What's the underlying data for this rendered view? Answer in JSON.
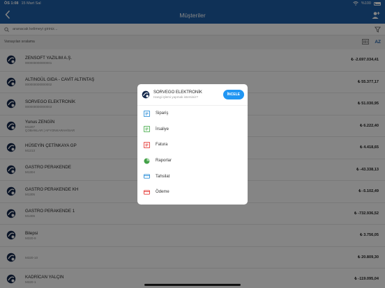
{
  "status": {
    "time": "ÖS 1:08",
    "date": "15 Mart Sal",
    "battery": "%100"
  },
  "nav": {
    "title": "Müşteriler",
    "back_icon": "chevron-left-icon",
    "action_icon": "add-user-icon"
  },
  "search": {
    "placeholder": "aranacak kelimeyi giriniz..."
  },
  "sort": {
    "label": "Varsayılan sıralama",
    "az": "AZ"
  },
  "customers": [
    {
      "name": "ZENSOFT YAZILIM A.Ş.",
      "code": "000000000000001",
      "sub": "",
      "balance": "₺ -2.697.034,41"
    },
    {
      "name": "ALTINGÜL GIDA - CAVİT ALTINTAŞ",
      "code": "000000000000002",
      "sub": "",
      "balance": "₺ 55.377,17"
    },
    {
      "name": "SORVEGO ELEKTRONİK",
      "code": "000000000000003",
      "sub": "",
      "balance": "₺ 51.030,95"
    },
    {
      "name": "Yunus ZENGİN",
      "code": "M1207",
      "sub": "ÇOBANLAR | AFYONKARAHİSAR",
      "balance": "₺ 6.222,40"
    },
    {
      "name": "HÜSEYİN ÇETİNKAYA GP",
      "code": "M1213",
      "sub": "",
      "balance": "₺ 4.418,65"
    },
    {
      "name": "GASTRO PERAKENDE",
      "code": "M1304",
      "sub": "",
      "balance": "₺ -43.338,13"
    },
    {
      "name": "GASTRO PERAKENDE KH",
      "code": "M1305",
      "sub": "",
      "balance": "₺ -5.102,49"
    },
    {
      "name": "GASTRO PERAKENDE 1",
      "code": "M1306",
      "sub": "",
      "balance": "₺ -732.936,52"
    },
    {
      "name": "Bilepsi",
      "code": "M320-9",
      "sub": "",
      "balance": "₺ 3.756,05"
    },
    {
      "name": "",
      "code": "M320-10",
      "sub": "",
      "balance": "₺ 20.809,30"
    },
    {
      "name": "KADRİCAN YALÇIN",
      "code": "M320-1",
      "sub": "",
      "balance": "₺ -119.095,04"
    }
  ],
  "dialog": {
    "name": "SORVEGO ELEKTRONİK",
    "question": "Hangi işlemi yapmak istersiniz?",
    "button": "İNCELE",
    "items": [
      {
        "label": "Sipariş",
        "icon": "order-icon",
        "color": "#2e8fd8"
      },
      {
        "label": "İrsaliye",
        "icon": "waybill-icon",
        "color": "#4caf50"
      },
      {
        "label": "Fatura",
        "icon": "invoice-icon",
        "color": "#e53935"
      },
      {
        "label": "Raporlar",
        "icon": "pie-chart-icon",
        "color": "#43a047"
      },
      {
        "label": "Tahsilat",
        "icon": "collection-icon",
        "color": "#2e8fd8"
      },
      {
        "label": "Ödeme",
        "icon": "payment-icon",
        "color": "#e53935"
      }
    ]
  },
  "colors": {
    "primary": "#1e5fa8",
    "accent": "#2196f3"
  }
}
